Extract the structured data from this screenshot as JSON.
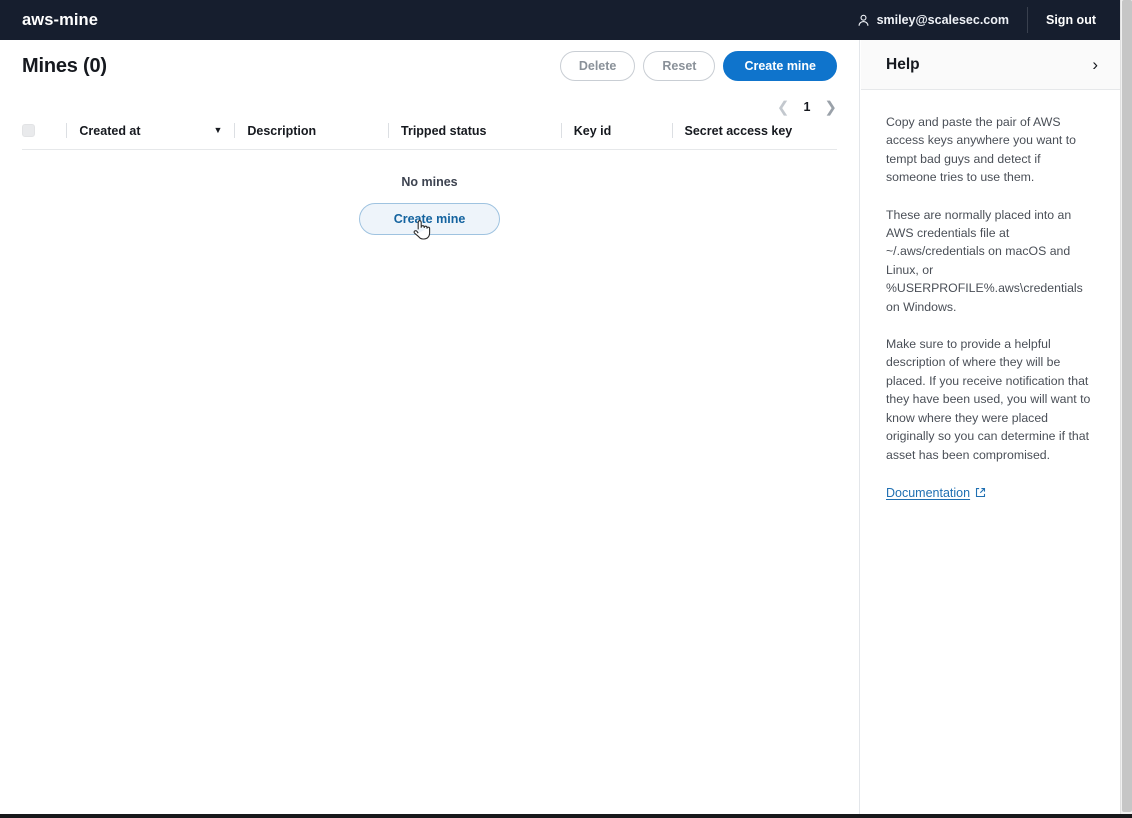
{
  "topnav": {
    "brand": "aws-mine",
    "user_email": "smiley@scalesec.com",
    "user_icon": "user-icon",
    "signout_label": "Sign out"
  },
  "toolbar": {
    "page_title": "Mines (0)",
    "delete_label": "Delete",
    "reset_label": "Reset",
    "create_label": "Create mine"
  },
  "pagination": {
    "prev_icon": "chevron-left-icon",
    "current_page": "1",
    "next_icon": "chevron-right-icon"
  },
  "table": {
    "select_all_checkbox": "select-all-checkbox",
    "sort_icon": "caret-down-icon",
    "columns": [
      {
        "label": "Created at"
      },
      {
        "label": "Description"
      },
      {
        "label": "Tripped status"
      },
      {
        "label": "Key id"
      },
      {
        "label": "Secret access key"
      }
    ],
    "empty_message": "No mines",
    "empty_create_label": "Create mine",
    "rows": []
  },
  "help": {
    "title": "Help",
    "chevron_icon": "chevron-right-icon",
    "paragraphs": [
      "Copy and paste the pair of AWS access keys anywhere you want to tempt bad guys and detect if someone tries to use them.",
      "These are normally placed into an AWS credentials file at ~/.aws/credentials on macOS and Linux, or %USERPROFILE%.aws\\credentials on Windows.",
      "Make sure to provide a helpful description of where they will be placed. If you receive notification that they have been used, you will want to know where they were placed originally so you can determine if that asset has been compromised."
    ],
    "documentation_label": "Documentation",
    "documentation_icon": "external-link-icon"
  },
  "colors": {
    "navbar": "#161e2e",
    "primary_blue": "#0f74cc",
    "link_blue": "#1f6fb2",
    "soft_blue_bg": "#eef4fa"
  }
}
